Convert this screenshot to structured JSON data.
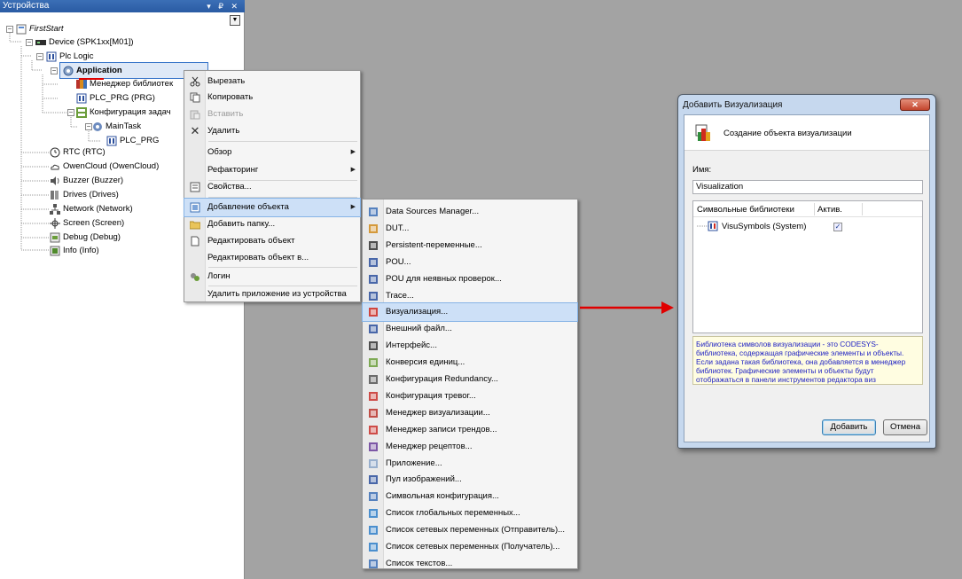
{
  "panel": {
    "title": "Устройства",
    "controls": "▾ ₽ ✕",
    "tree": {
      "first_start": "FirstStart",
      "device": "Device (SPK1xx[M01])",
      "plc_logic": "Plc Logic",
      "application": "Application",
      "library_manager": "Менеджер библиотек",
      "plc_prg": "PLC_PRG (PRG)",
      "task_config": "Конфигурация задач",
      "main_task": "MainTask",
      "main_task_prg": "PLC_PRG",
      "rtc": "RTC (RTC)",
      "owencloud": "OwenCloud (OwenCloud)",
      "buzzer": "Buzzer (Buzzer)",
      "drives": "Drives (Drives)",
      "network": "Network (Network)",
      "screen": "Screen (Screen)",
      "debug": "Debug (Debug)",
      "info": "Info (Info)"
    }
  },
  "context_menu": {
    "cut": "Вырезать",
    "copy": "Копировать",
    "paste": "Вставить",
    "delete": "Удалить",
    "browse": "Обзор",
    "refactoring": "Рефакторинг",
    "properties": "Свойства...",
    "add_object": "Добавление объекта",
    "add_folder": "Добавить папку...",
    "edit_object": "Редактировать объект",
    "edit_object_with": "Редактировать объект в...",
    "login": "Логин",
    "remove_app": "Удалить приложение из устройства"
  },
  "submenu": {
    "items": [
      "Data Sources Manager...",
      "DUT...",
      "Persistent-переменные...",
      "POU...",
      "POU для неявных проверок...",
      "Trace...",
      "Визуализация...",
      "Внешний файл...",
      "Интерфейс...",
      "Конверсия единиц...",
      "Конфигурация Redundancy...",
      "Конфигурация тревог...",
      "Менеджер визуализации...",
      "Менеджер записи трендов...",
      "Менеджер рецептов...",
      "Приложение...",
      "Пул изображений...",
      "Символьная конфигурация...",
      "Список глобальных переменных...",
      "Список сетевых переменных (Отправитель)...",
      "Список сетевых переменных (Получатель)...",
      "Список текстов..."
    ],
    "highlighted_index": 6
  },
  "dialog": {
    "title": "Добавить Визуализация",
    "close": "✕",
    "header_text": "Создание объекта визуализации",
    "name_label": "Имя:",
    "name_value": "Visualization",
    "col_libraries": "Символьные библиотеки",
    "col_active": "Актив.",
    "library_row": "VisuSymbols (System)",
    "library_active": "✓",
    "description": "Библиотека символов визуализации - это CODESYS-библиотека, содержащая графические элементы и объекты. Если задана такая библиотека, она добавляется в менеджер библиотек. Графические элементы и объекты будут отображаться в панели инструментов редактора виз",
    "add_button": "Добавить",
    "cancel_button": "Отмена"
  },
  "colors": {
    "background": "#a3a3a3",
    "title_bar": "#2a5ba3",
    "arrow": "#e00000",
    "highlight": "#cde0f7",
    "description_text": "#1c1ec3"
  }
}
